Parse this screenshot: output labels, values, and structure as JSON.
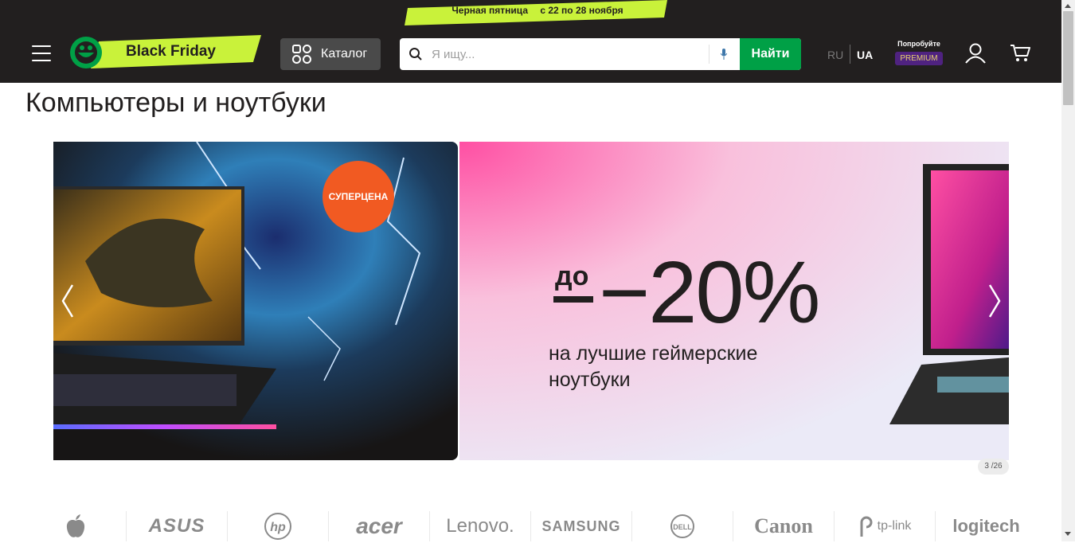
{
  "promo": {
    "title": "Черная пятница",
    "dates": "с 22 по 28 ноября",
    "accent": "#c9f23a"
  },
  "header": {
    "logo_label": "Black Friday",
    "catalog_label": "Каталог",
    "search_placeholder": "Я ищу...",
    "find_label": "Найти",
    "lang_ru": "RU",
    "lang_ua": "UA",
    "premium_try": "Попробуйте",
    "premium_badge": "PREMIUM",
    "colors": {
      "background": "#221f1f",
      "find_button": "#00a046",
      "premium": "#4f2280"
    }
  },
  "page": {
    "title": "Компьютеры и ноутбуки"
  },
  "carousel": {
    "slides": [
      {
        "badge": "СУПЕРЦЕНА",
        "image": "gaming-laptop-dragon"
      },
      {
        "prefix": "до",
        "discount": "−20%",
        "subtitle": "на лучшие геймерские ноутбуки",
        "image": "gaming-laptop-pink"
      }
    ],
    "counter": "3 /26"
  },
  "brands": [
    {
      "name": "apple",
      "icon": "apple-logo-icon"
    },
    {
      "name": "ASUS",
      "icon": "asus-logo"
    },
    {
      "name": "hp",
      "icon": "hp-logo"
    },
    {
      "name": "acer",
      "icon": "acer-logo"
    },
    {
      "name": "Lenovo.",
      "icon": "lenovo-logo"
    },
    {
      "name": "SAMSUNG",
      "icon": "samsung-logo"
    },
    {
      "name": "DELL",
      "icon": "dell-logo"
    },
    {
      "name": "Canon",
      "icon": "canon-logo"
    },
    {
      "name": "tp-link",
      "icon": "tplink-logo"
    },
    {
      "name": "logitech",
      "icon": "logitech-logo"
    }
  ]
}
